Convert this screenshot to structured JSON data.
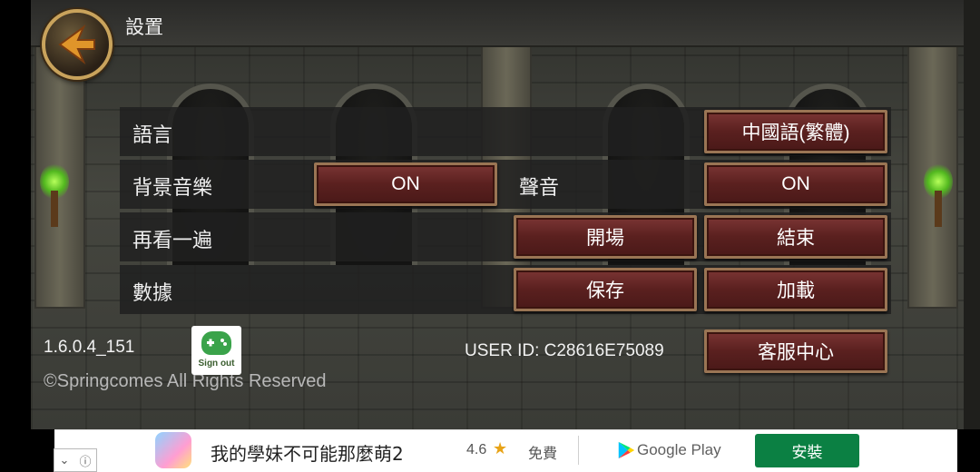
{
  "header": {
    "title": "設置"
  },
  "settings": {
    "language": {
      "label": "語言",
      "value": "中國語(繁體)"
    },
    "bgm": {
      "label": "背景音樂",
      "value": "ON"
    },
    "sound": {
      "label": "聲音",
      "value": "ON"
    },
    "replay": {
      "label": "再看一遍",
      "opening": "開場",
      "ending": "結束"
    },
    "data": {
      "label": "數據",
      "save": "保存",
      "load": "加載"
    }
  },
  "footer": {
    "version": "1.6.0.4_151",
    "copyright": "©Springcomes All Rights Reserved",
    "google_play_games": {
      "label": "Sign out"
    },
    "user_id": "USER ID: C28616E75089",
    "support_button": "客服中心"
  },
  "ad": {
    "title": "我的學妹不可能那麼萌2",
    "rating": "4.6",
    "price": "免費",
    "store": "Google Play",
    "install_button": "安裝"
  },
  "colors": {
    "button_fill": "#5a201f",
    "button_border": "#9a7554",
    "install_green": "#0b8043"
  }
}
